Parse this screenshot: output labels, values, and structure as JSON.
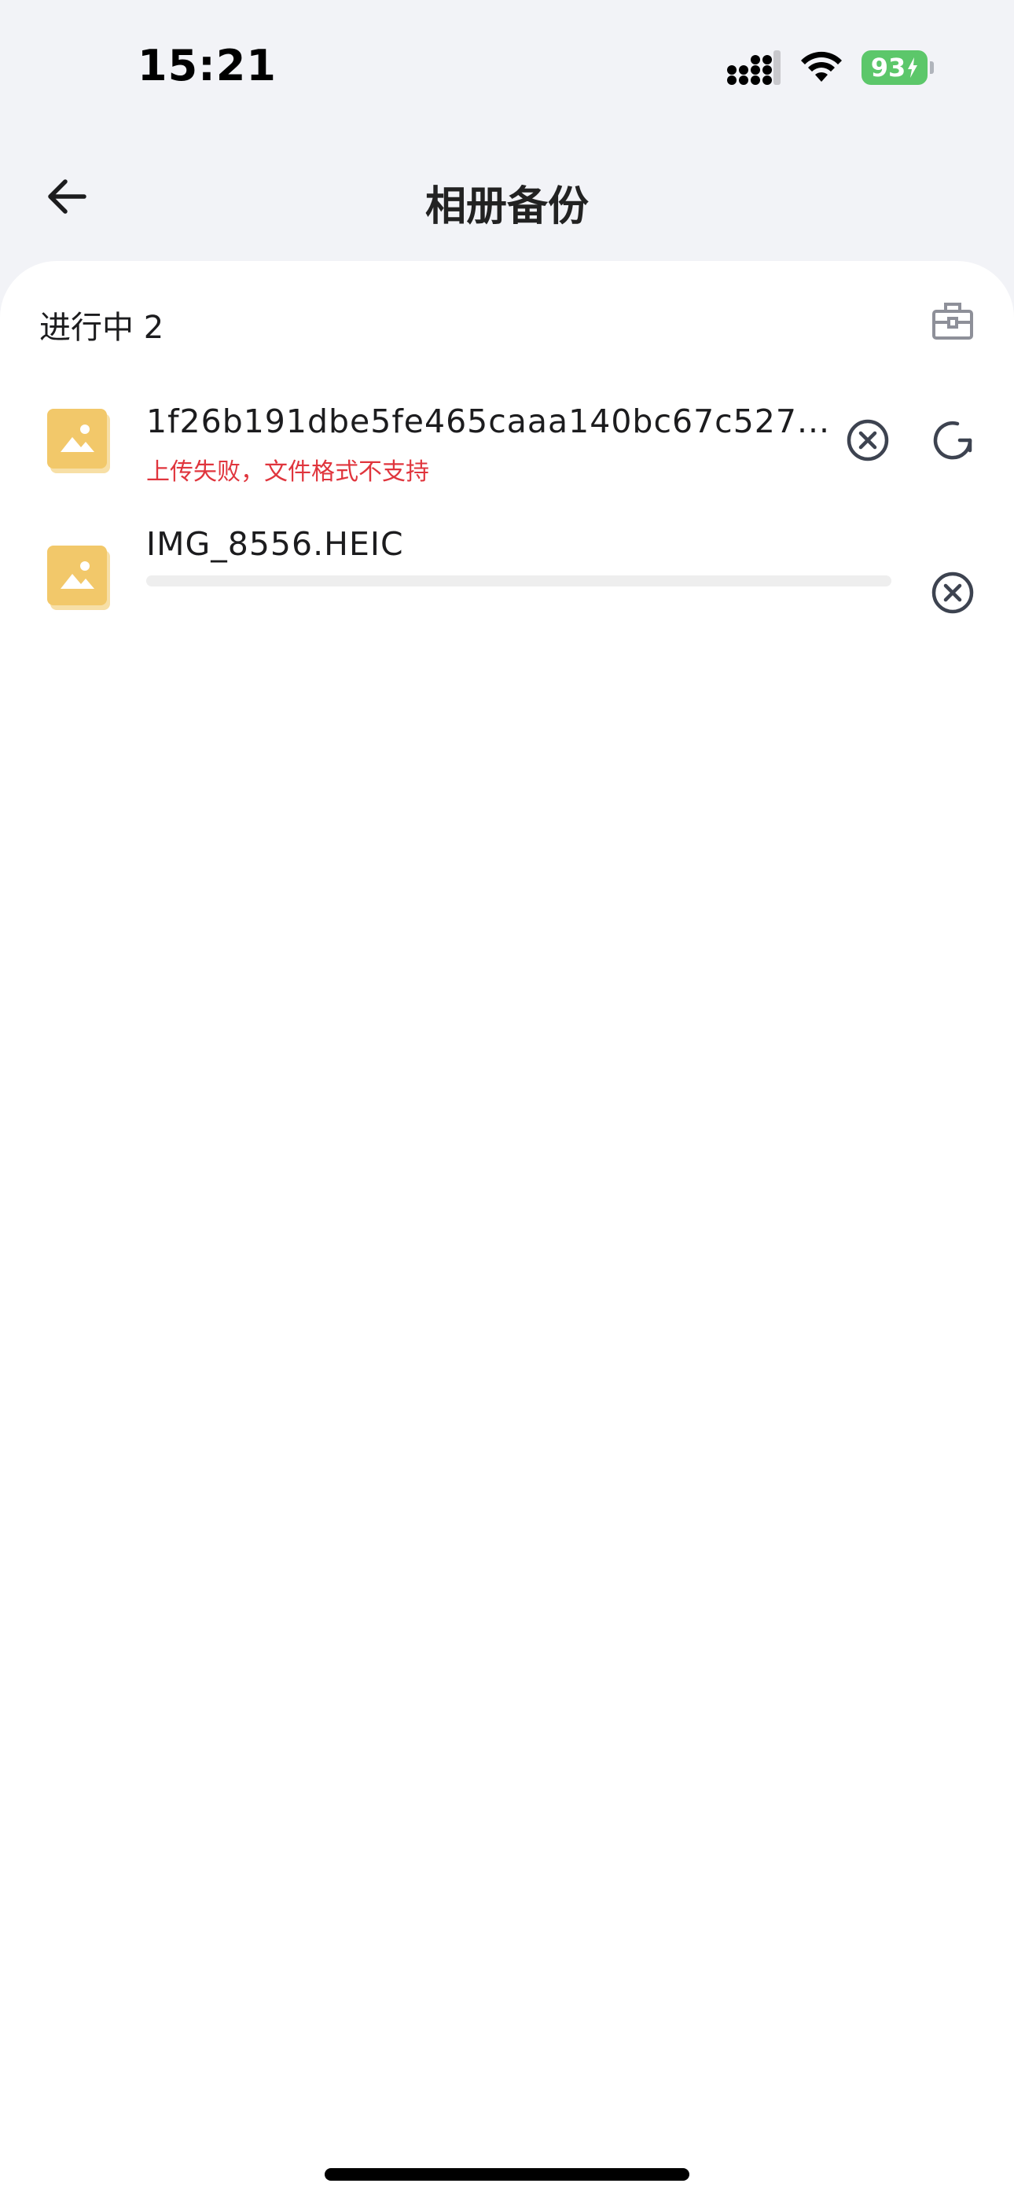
{
  "status_bar": {
    "time": "15:21",
    "battery": "93"
  },
  "nav": {
    "title": "相册备份"
  },
  "section": {
    "label": "进行中 2"
  },
  "tasks": [
    {
      "name": "1f26b191dbe5fe465caaa140bc67c527...",
      "status": "上传失败，文件格式不支持"
    },
    {
      "name": "IMG_8556.HEIC",
      "progress": 0
    }
  ],
  "colors": {
    "error": "#e0353d",
    "battery": "#5cc76a",
    "file_icon": "#f2c86a",
    "page_bg": "#f2f3f7",
    "icon_gray": "#3d4350"
  },
  "icons": {
    "back": "arrow-left-icon",
    "toolbox": "toolbox-icon",
    "cancel": "close-circle-icon",
    "retry": "refresh-icon",
    "file": "image-file-icon"
  }
}
